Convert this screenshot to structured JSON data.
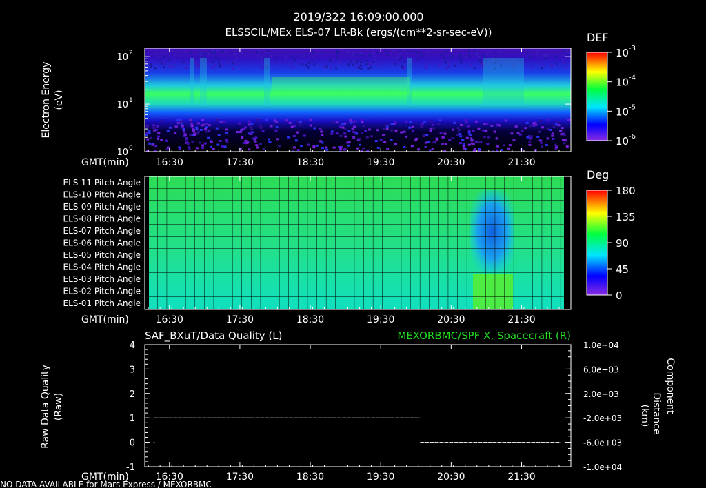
{
  "header": {
    "timestamp": "2019/322 16:09:00.000",
    "title": "ELSSCIL/MEx ELS-07 LR-Bk  (ergs/(cm**2-sr-sec-eV))"
  },
  "footer": {
    "note": "NO DATA AVAILABLE for Mars Express / MEXORBMC"
  },
  "time_axis": {
    "label": "GMT(min)",
    "ticks": [
      "16:30",
      "17:30",
      "18:30",
      "19:30",
      "20:30",
      "21:30"
    ],
    "tick_values_hours": [
      16.5,
      17.5,
      18.5,
      19.5,
      20.5,
      21.5
    ],
    "range_hours": [
      16.15,
      22.2
    ]
  },
  "chart_data": [
    {
      "type": "heatmap",
      "name": "spectrogram",
      "ylabel": "Electron Energy (eV)",
      "ylabel_lines": [
        "Electron Energy",
        "(eV)"
      ],
      "yscale": "log",
      "ylim": [
        1,
        150
      ],
      "ytick_base": "10",
      "yticks": [
        {
          "value": 1,
          "exp": "0"
        },
        {
          "value": 10,
          "exp": "1"
        },
        {
          "value": 100,
          "exp": "2"
        }
      ],
      "colorbar": {
        "title": "DEF",
        "scale": "log",
        "range": [
          1e-06,
          0.001
        ],
        "ticks": [
          {
            "base": "10",
            "exp": "-3"
          },
          {
            "base": "10",
            "exp": "-4"
          },
          {
            "base": "10",
            "exp": "-5"
          },
          {
            "base": "10",
            "exp": "-6"
          }
        ]
      }
    },
    {
      "type": "heatmap",
      "name": "pitch-angle",
      "rows": [
        "ELS-11 Pitch Angle",
        "ELS-10 Pitch Angle",
        "ELS-09 Pitch Angle",
        "ELS-08 Pitch Angle",
        "ELS-07 Pitch Angle",
        "ELS-06 Pitch Angle",
        "ELS-05 Pitch Angle",
        "ELS-04 Pitch Angle",
        "ELS-03 Pitch Angle",
        "ELS-02 Pitch Angle",
        "ELS-01 Pitch Angle"
      ],
      "approx_values_deg": [
        95,
        94,
        92,
        90,
        88,
        86,
        84,
        80,
        76,
        72,
        70
      ],
      "dip_hours": [
        20.8,
        21.45
      ],
      "colorbar": {
        "title": "Deg",
        "ticks": [
          "180",
          "135",
          "90",
          "45",
          "0"
        ],
        "range": [
          0,
          180
        ]
      }
    },
    {
      "type": "line",
      "name": "data-quality",
      "title_left": "SAF_BXuT/Data Quality (L)",
      "title_right": "MEXORBMC/SPF X, Spacecraft (R)",
      "ylabel_left": "Raw Data Quality (Raw)",
      "ylabel_left_lines": [
        "Raw Data Quality",
        "(Raw)"
      ],
      "ylabel_right": "Component Distance (km)",
      "ylabel_right_lines": [
        "Component",
        "Distance",
        "(km)"
      ],
      "ylim_left": [
        -1,
        4
      ],
      "yticks_left": [
        "4",
        "3",
        "2",
        "1",
        "0",
        "-1"
      ],
      "ylim_right": [
        -10000,
        10000
      ],
      "yticks_right": [
        "1.0e+04",
        "6.0e+03",
        "2.0e+03",
        "-2.0e+03",
        "-6.0e+03",
        "-1.0e+04"
      ],
      "series": [
        {
          "x_hours": [
            16.28,
            20.06
          ],
          "values": [
            1,
            1
          ]
        },
        {
          "x_hours": [
            20.06,
            22.05
          ],
          "values": [
            0,
            0
          ]
        }
      ],
      "points": [
        {
          "x_hours": 16.28,
          "value": 0
        }
      ]
    }
  ]
}
